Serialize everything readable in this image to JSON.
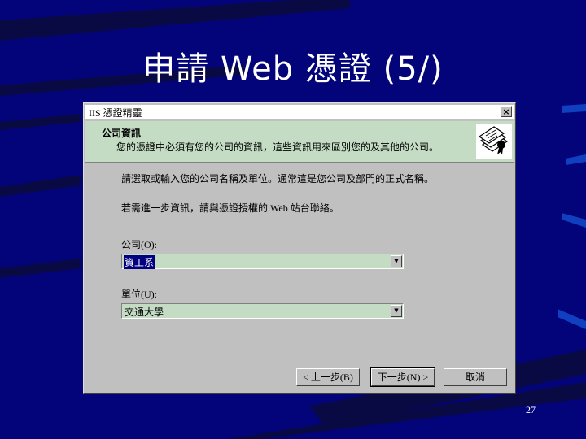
{
  "slide": {
    "title": "申請 Web 憑證 (5/)",
    "page_number": "27"
  },
  "wizard": {
    "window_title": "IIS 憑證精靈",
    "close_glyph": "×",
    "header_title": "公司資訊",
    "header_subtitle": "您的憑證中必須有您的公司的資訊，這些資訊用來區別您的及其他的公司。",
    "body_line1": "請選取或輸入您的公司名稱及單位。通常這是您公司及部門的正式名稱。",
    "body_line2": "若需進一步資訊，請與憑證授權的 Web 站台聯絡。",
    "company_label": "公司(O):",
    "company_value": "資工系",
    "unit_label": "單位(U):",
    "unit_value": "交通大學",
    "back_button": "< 上一步(B)",
    "next_button": "下一步(N) >",
    "cancel_button": "取消",
    "header_icon": "certificate-wizard-icon",
    "dropdown_icon": "chevron-down-icon"
  },
  "colors": {
    "slide_background": "#03037a",
    "header_background": "#c3dcc3",
    "selection": "#000080"
  }
}
